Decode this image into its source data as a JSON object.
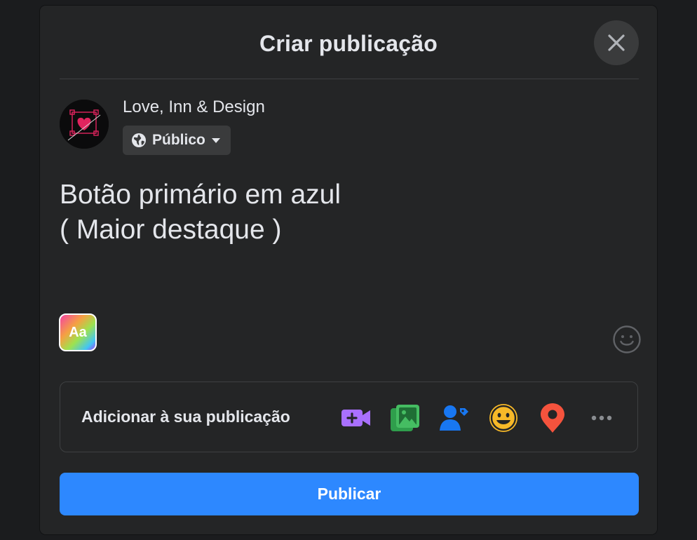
{
  "dialog": {
    "title": "Criar publicação",
    "close_icon": "close-icon"
  },
  "author": {
    "name": "Love, Inn & Design",
    "audience": {
      "label": "Público",
      "icon": "globe-icon",
      "dropdown_icon": "caret-down-icon"
    }
  },
  "post": {
    "text": "Botão primário em azul\n( Maior destaque )"
  },
  "background_picker": {
    "label": "Aa"
  },
  "add_to_post": {
    "label": "Adicionar à sua publicação",
    "icons": [
      {
        "name": "live-video-icon",
        "color": "#a970ff"
      },
      {
        "name": "photo-video-icon",
        "color": "#45bd62"
      },
      {
        "name": "tag-people-icon",
        "color": "#1877f2"
      },
      {
        "name": "feeling-icon",
        "color": "#f7b928"
      },
      {
        "name": "check-in-icon",
        "color": "#f5533d"
      },
      {
        "name": "more-icon",
        "color": "#b0b3b8"
      }
    ]
  },
  "publish": {
    "label": "Publicar",
    "color": "#2d88ff"
  },
  "theme": {
    "surface": "#242526",
    "button_gray": "#3a3b3c",
    "text_primary": "#e4e6eb",
    "divider": "#3e4042"
  }
}
